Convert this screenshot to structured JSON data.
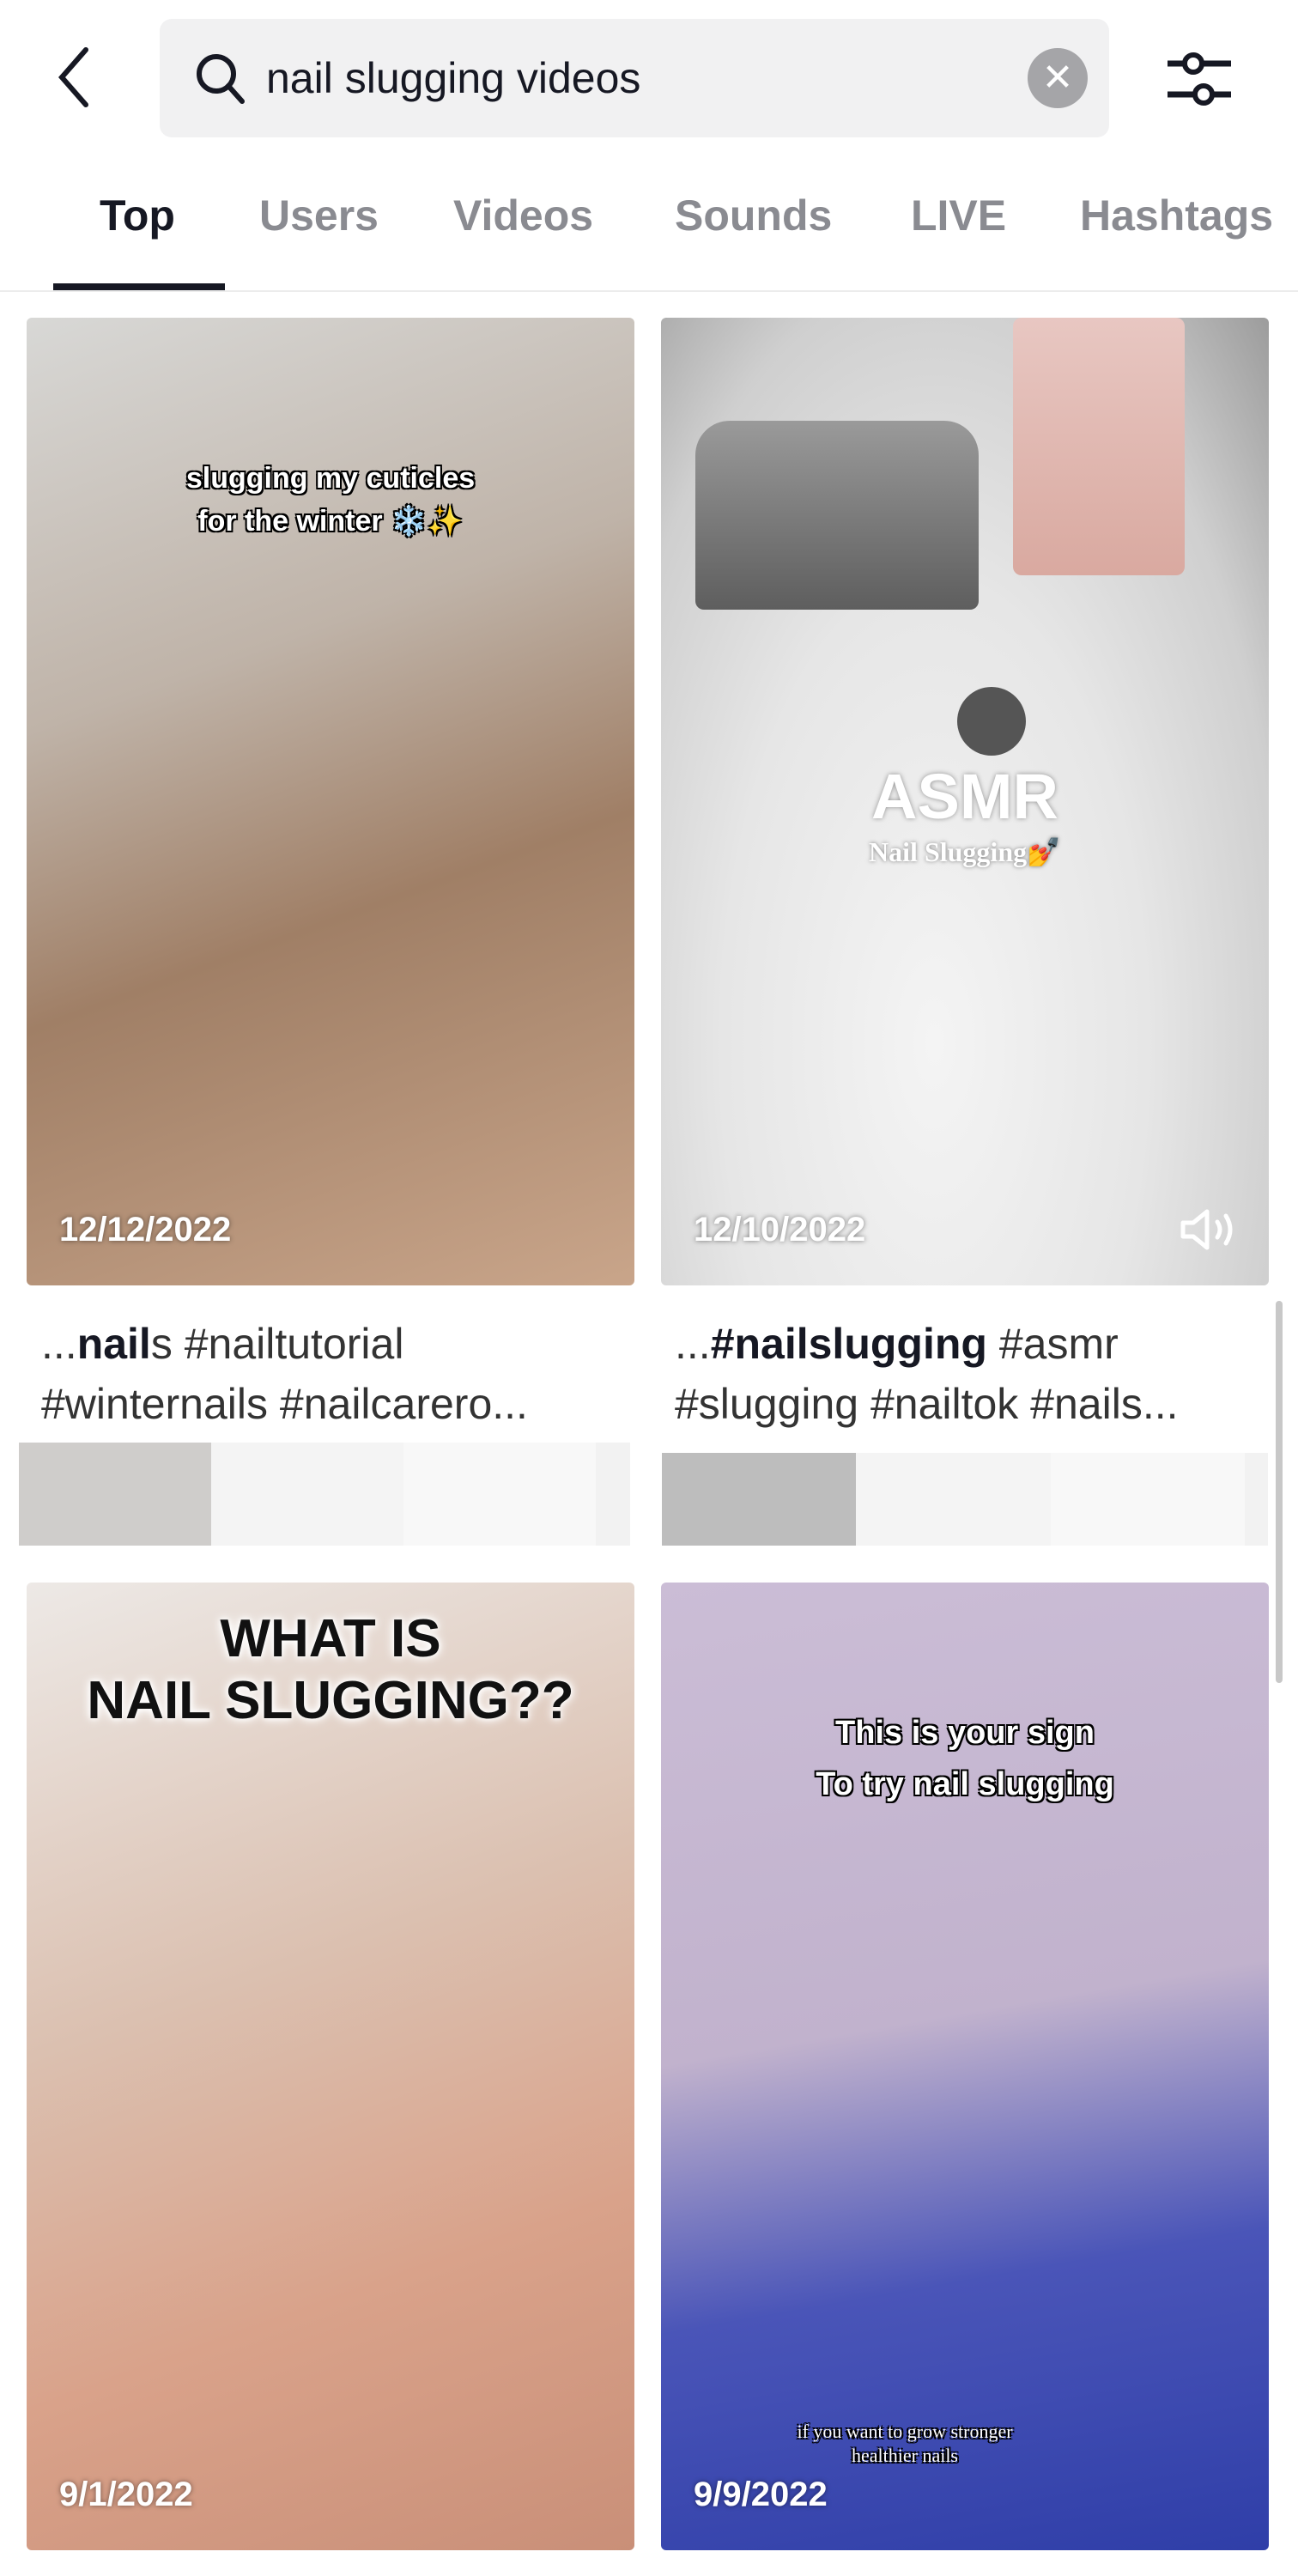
{
  "header": {
    "back_icon": "chevron-left-icon",
    "search_icon": "search-icon",
    "query": "nail slugging videos",
    "clear_icon": "clear-x-icon",
    "filter_icon": "sliders-icon"
  },
  "tabs": [
    {
      "label": "Top",
      "active": true
    },
    {
      "label": "Users"
    },
    {
      "label": "Videos"
    },
    {
      "label": "Sounds"
    },
    {
      "label": "LIVE"
    },
    {
      "label": "Hashtags"
    }
  ],
  "results": [
    {
      "overlay": "slugging my cuticles\nfor the winter ❄️✨",
      "date": "12/12/2022",
      "caption_bold": "nail",
      "caption_rest": "s #nailtutorial",
      "caption_prefix": "...",
      "caption_line2": "#winternails #nailcarero..."
    },
    {
      "overlay_title": "ASMR",
      "overlay": "Nail Slugging💅",
      "date": "12/10/2022",
      "sound_icon": "speaker-icon",
      "caption_prefix": "...",
      "caption_bold": "#nailslugging",
      "caption_rest": " #asmr",
      "caption_line2": "#slugging #nailtok #nails..."
    },
    {
      "overlay": "WHAT IS\nNAIL SLUGGING??",
      "date": "9/1/2022"
    },
    {
      "overlay": "This is your sign\nTo try nail slugging",
      "overlay_bottom": "if you want to grow stronger\nhealthier nails",
      "date": "9/9/2022"
    }
  ]
}
